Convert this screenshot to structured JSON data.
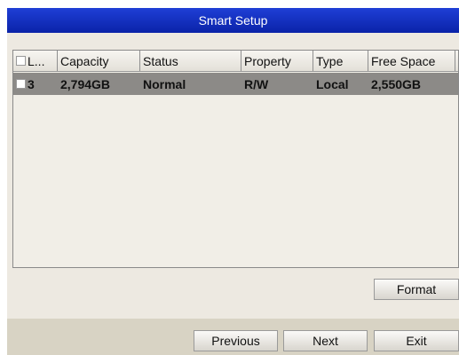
{
  "dialog": {
    "title": "Smart Setup"
  },
  "table": {
    "headers": [
      "L...",
      "Capacity",
      "Status",
      "Property",
      "Type",
      "Free Space",
      ""
    ],
    "rows": [
      {
        "label": "3",
        "capacity": "2,794GB",
        "status": "Normal",
        "property": "R/W",
        "type": "Local",
        "free_space": "2,550GB",
        "checked": false
      }
    ]
  },
  "buttons": {
    "format": "Format",
    "previous": "Previous",
    "next": "Next",
    "exit": "Exit"
  },
  "colors": {
    "title_bar": "#0a23a8",
    "selected_row": "#8c8a87",
    "body_bg": "#ede9e1",
    "footer_bg": "#d8d3c4"
  }
}
